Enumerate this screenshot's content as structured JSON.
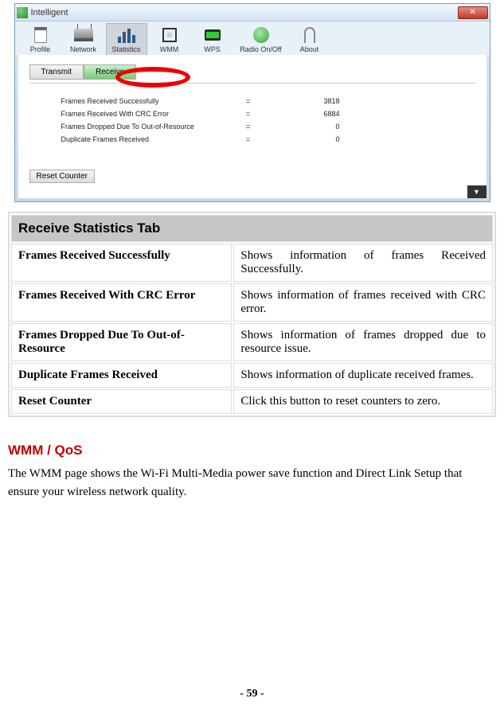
{
  "app": {
    "title": "Intelligent",
    "toolbar": [
      {
        "label": "Profile"
      },
      {
        "label": "Network"
      },
      {
        "label": "Statistics"
      },
      {
        "label": "WMM"
      },
      {
        "label": "WPS"
      },
      {
        "label": "Radio On/Off"
      },
      {
        "label": "About"
      }
    ],
    "subtabs": {
      "transmit": "Transmit",
      "receive": "Receive"
    },
    "stats": [
      {
        "label": "Frames Received Successfully",
        "eq": "=",
        "value": "3818"
      },
      {
        "label": "Frames Received With CRC Error",
        "eq": "=",
        "value": "6884"
      },
      {
        "label": "Frames Dropped Due To Out-of-Resource",
        "eq": "=",
        "value": "0"
      },
      {
        "label": "Duplicate Frames Received",
        "eq": "=",
        "value": "0"
      }
    ],
    "reset_label": "Reset Counter"
  },
  "doc": {
    "header": "Receive Statistics Tab",
    "rows": [
      {
        "key": "Frames Received Successfully",
        "desc": "Shows information of frames Received Successfully."
      },
      {
        "key": "Frames Received With CRC Error",
        "desc": "Shows information of frames received with CRC error."
      },
      {
        "key": "Frames Dropped Due To Out-of-Resource",
        "desc": "Shows information of frames dropped due to resource issue."
      },
      {
        "key": "Duplicate Frames Received",
        "desc": "Shows information of duplicate received frames."
      },
      {
        "key": "Reset Counter",
        "desc": "Click this button to reset counters to zero."
      }
    ]
  },
  "section": {
    "heading": "WMM / QoS",
    "body": "The WMM page shows the Wi-Fi Multi-Media power save function and Direct Link Setup that ensure your wireless network quality."
  },
  "page_number": "- 59 -"
}
